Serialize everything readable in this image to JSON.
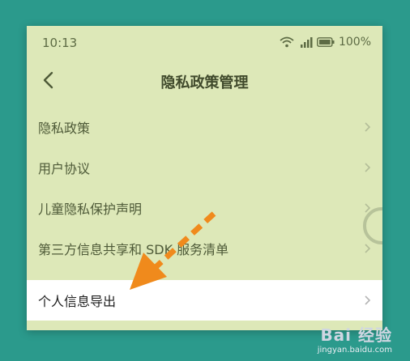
{
  "status_bar": {
    "time": "10:13",
    "battery": "100%"
  },
  "header": {
    "title": "隐私政策管理"
  },
  "menu": {
    "items": [
      {
        "label": "隐私政策"
      },
      {
        "label": "用户协议"
      },
      {
        "label": "儿童隐私保护声明"
      },
      {
        "label": "第三方信息共享和 SDK 服务清单"
      }
    ],
    "highlighted_item": {
      "label": "个人信息导出"
    }
  },
  "watermark": {
    "logo": "Bai 经验",
    "url": "jingyan.baidu.com"
  },
  "colors": {
    "page_background": "#2b9a8c",
    "screen_background": "#dde8b8",
    "arrow": "#f08a1c"
  },
  "icons": {
    "back": "chevron-left-icon",
    "item_chevron": "chevron-right-icon",
    "wifi": "wifi-icon",
    "signal": "signal-icon",
    "battery": "battery-icon"
  }
}
